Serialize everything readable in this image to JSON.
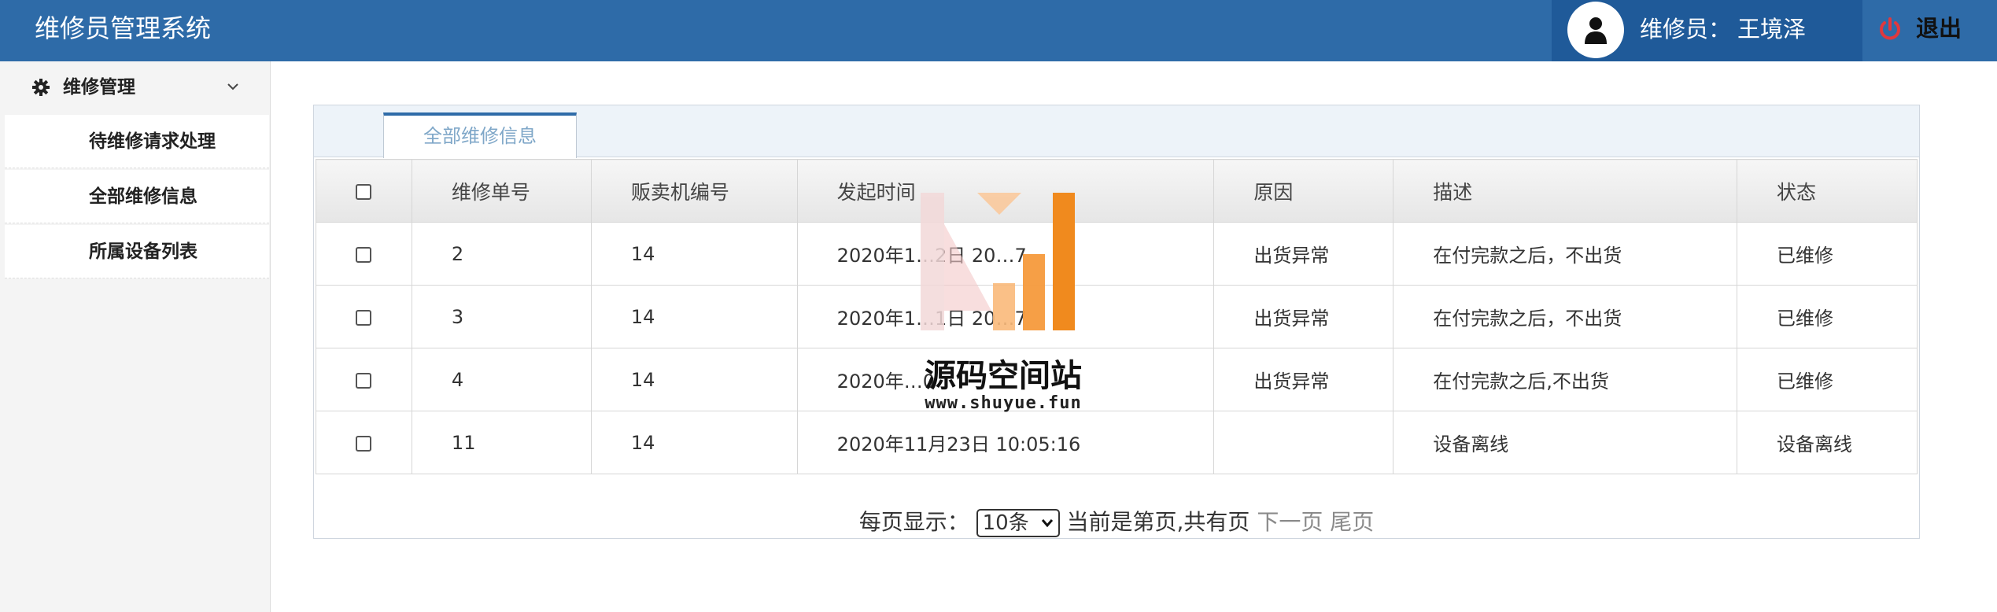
{
  "header": {
    "title": "维修员管理系统",
    "user_role": "维修员：",
    "user_name": "王境泽",
    "logout_label": "退出"
  },
  "sidebar": {
    "group_title": "维修管理",
    "items": [
      {
        "label": "待维修请求处理"
      },
      {
        "label": "全部维修信息"
      },
      {
        "label": "所属设备列表"
      }
    ]
  },
  "tabs": [
    {
      "label": "全部维修信息",
      "active": true
    }
  ],
  "table": {
    "columns": [
      "维修单号",
      "贩卖机编号",
      "发起时间",
      "原因",
      "描述",
      "状态"
    ],
    "rows": [
      {
        "id": "2",
        "machine": "14",
        "time": "2020年1…2日 20…7",
        "reason": "出货异常",
        "desc": "在付完款之后，不出货",
        "status": "已维修"
      },
      {
        "id": "3",
        "machine": "14",
        "time": "2020年1…1日 20…7",
        "reason": "出货异常",
        "desc": "在付完款之后，不出货",
        "status": "已维修"
      },
      {
        "id": "4",
        "machine": "14",
        "time": "2020年…0",
        "reason": "出货异常",
        "desc": "在付完款之后,不出货",
        "status": "已维修"
      },
      {
        "id": "11",
        "machine": "14",
        "time": "2020年11月23日 10:05:16",
        "reason": "",
        "desc": "设备离线",
        "status": "设备离线"
      }
    ]
  },
  "pager": {
    "per_page_label": "每页显示：",
    "per_page_value": "10条",
    "status_text": "当前是第页,共有页",
    "next_label": "下一页",
    "last_label": "尾页"
  },
  "watermark": {
    "text": "源码空间站",
    "url": "www.shuyue.fun"
  },
  "colors": {
    "header_bg": "#2e6ba8",
    "user_box_bg": "#1f5a99",
    "logout_icon": "#e0383e",
    "tab_text": "#7fa7c8"
  }
}
